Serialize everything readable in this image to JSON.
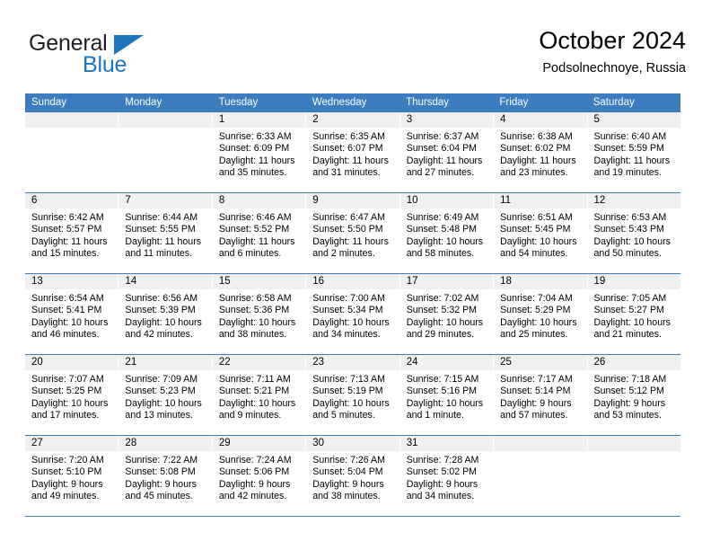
{
  "brand": {
    "line1": "General",
    "line2": "Blue",
    "triangle_color": "#1d76bd",
    "text_color": "#231f20"
  },
  "header": {
    "title": "October 2024",
    "subtitle": "Podsolnechnoye, Russia"
  },
  "calendar": {
    "accent_color": "#3b7dbf",
    "daynum_bg": "#f0f0f0",
    "weekdays": [
      "Sunday",
      "Monday",
      "Tuesday",
      "Wednesday",
      "Thursday",
      "Friday",
      "Saturday"
    ],
    "weeks": [
      [
        {
          "day": "",
          "sunrise": "",
          "sunset": "",
          "daylight1": "",
          "daylight2": ""
        },
        {
          "day": "",
          "sunrise": "",
          "sunset": "",
          "daylight1": "",
          "daylight2": ""
        },
        {
          "day": "1",
          "sunrise": "Sunrise: 6:33 AM",
          "sunset": "Sunset: 6:09 PM",
          "daylight1": "Daylight: 11 hours",
          "daylight2": "and 35 minutes."
        },
        {
          "day": "2",
          "sunrise": "Sunrise: 6:35 AM",
          "sunset": "Sunset: 6:07 PM",
          "daylight1": "Daylight: 11 hours",
          "daylight2": "and 31 minutes."
        },
        {
          "day": "3",
          "sunrise": "Sunrise: 6:37 AM",
          "sunset": "Sunset: 6:04 PM",
          "daylight1": "Daylight: 11 hours",
          "daylight2": "and 27 minutes."
        },
        {
          "day": "4",
          "sunrise": "Sunrise: 6:38 AM",
          "sunset": "Sunset: 6:02 PM",
          "daylight1": "Daylight: 11 hours",
          "daylight2": "and 23 minutes."
        },
        {
          "day": "5",
          "sunrise": "Sunrise: 6:40 AM",
          "sunset": "Sunset: 5:59 PM",
          "daylight1": "Daylight: 11 hours",
          "daylight2": "and 19 minutes."
        }
      ],
      [
        {
          "day": "6",
          "sunrise": "Sunrise: 6:42 AM",
          "sunset": "Sunset: 5:57 PM",
          "daylight1": "Daylight: 11 hours",
          "daylight2": "and 15 minutes."
        },
        {
          "day": "7",
          "sunrise": "Sunrise: 6:44 AM",
          "sunset": "Sunset: 5:55 PM",
          "daylight1": "Daylight: 11 hours",
          "daylight2": "and 11 minutes."
        },
        {
          "day": "8",
          "sunrise": "Sunrise: 6:46 AM",
          "sunset": "Sunset: 5:52 PM",
          "daylight1": "Daylight: 11 hours",
          "daylight2": "and 6 minutes."
        },
        {
          "day": "9",
          "sunrise": "Sunrise: 6:47 AM",
          "sunset": "Sunset: 5:50 PM",
          "daylight1": "Daylight: 11 hours",
          "daylight2": "and 2 minutes."
        },
        {
          "day": "10",
          "sunrise": "Sunrise: 6:49 AM",
          "sunset": "Sunset: 5:48 PM",
          "daylight1": "Daylight: 10 hours",
          "daylight2": "and 58 minutes."
        },
        {
          "day": "11",
          "sunrise": "Sunrise: 6:51 AM",
          "sunset": "Sunset: 5:45 PM",
          "daylight1": "Daylight: 10 hours",
          "daylight2": "and 54 minutes."
        },
        {
          "day": "12",
          "sunrise": "Sunrise: 6:53 AM",
          "sunset": "Sunset: 5:43 PM",
          "daylight1": "Daylight: 10 hours",
          "daylight2": "and 50 minutes."
        }
      ],
      [
        {
          "day": "13",
          "sunrise": "Sunrise: 6:54 AM",
          "sunset": "Sunset: 5:41 PM",
          "daylight1": "Daylight: 10 hours",
          "daylight2": "and 46 minutes."
        },
        {
          "day": "14",
          "sunrise": "Sunrise: 6:56 AM",
          "sunset": "Sunset: 5:39 PM",
          "daylight1": "Daylight: 10 hours",
          "daylight2": "and 42 minutes."
        },
        {
          "day": "15",
          "sunrise": "Sunrise: 6:58 AM",
          "sunset": "Sunset: 5:36 PM",
          "daylight1": "Daylight: 10 hours",
          "daylight2": "and 38 minutes."
        },
        {
          "day": "16",
          "sunrise": "Sunrise: 7:00 AM",
          "sunset": "Sunset: 5:34 PM",
          "daylight1": "Daylight: 10 hours",
          "daylight2": "and 34 minutes."
        },
        {
          "day": "17",
          "sunrise": "Sunrise: 7:02 AM",
          "sunset": "Sunset: 5:32 PM",
          "daylight1": "Daylight: 10 hours",
          "daylight2": "and 29 minutes."
        },
        {
          "day": "18",
          "sunrise": "Sunrise: 7:04 AM",
          "sunset": "Sunset: 5:29 PM",
          "daylight1": "Daylight: 10 hours",
          "daylight2": "and 25 minutes."
        },
        {
          "day": "19",
          "sunrise": "Sunrise: 7:05 AM",
          "sunset": "Sunset: 5:27 PM",
          "daylight1": "Daylight: 10 hours",
          "daylight2": "and 21 minutes."
        }
      ],
      [
        {
          "day": "20",
          "sunrise": "Sunrise: 7:07 AM",
          "sunset": "Sunset: 5:25 PM",
          "daylight1": "Daylight: 10 hours",
          "daylight2": "and 17 minutes."
        },
        {
          "day": "21",
          "sunrise": "Sunrise: 7:09 AM",
          "sunset": "Sunset: 5:23 PM",
          "daylight1": "Daylight: 10 hours",
          "daylight2": "and 13 minutes."
        },
        {
          "day": "22",
          "sunrise": "Sunrise: 7:11 AM",
          "sunset": "Sunset: 5:21 PM",
          "daylight1": "Daylight: 10 hours",
          "daylight2": "and 9 minutes."
        },
        {
          "day": "23",
          "sunrise": "Sunrise: 7:13 AM",
          "sunset": "Sunset: 5:19 PM",
          "daylight1": "Daylight: 10 hours",
          "daylight2": "and 5 minutes."
        },
        {
          "day": "24",
          "sunrise": "Sunrise: 7:15 AM",
          "sunset": "Sunset: 5:16 PM",
          "daylight1": "Daylight: 10 hours",
          "daylight2": "and 1 minute."
        },
        {
          "day": "25",
          "sunrise": "Sunrise: 7:17 AM",
          "sunset": "Sunset: 5:14 PM",
          "daylight1": "Daylight: 9 hours",
          "daylight2": "and 57 minutes."
        },
        {
          "day": "26",
          "sunrise": "Sunrise: 7:18 AM",
          "sunset": "Sunset: 5:12 PM",
          "daylight1": "Daylight: 9 hours",
          "daylight2": "and 53 minutes."
        }
      ],
      [
        {
          "day": "27",
          "sunrise": "Sunrise: 7:20 AM",
          "sunset": "Sunset: 5:10 PM",
          "daylight1": "Daylight: 9 hours",
          "daylight2": "and 49 minutes."
        },
        {
          "day": "28",
          "sunrise": "Sunrise: 7:22 AM",
          "sunset": "Sunset: 5:08 PM",
          "daylight1": "Daylight: 9 hours",
          "daylight2": "and 45 minutes."
        },
        {
          "day": "29",
          "sunrise": "Sunrise: 7:24 AM",
          "sunset": "Sunset: 5:06 PM",
          "daylight1": "Daylight: 9 hours",
          "daylight2": "and 42 minutes."
        },
        {
          "day": "30",
          "sunrise": "Sunrise: 7:26 AM",
          "sunset": "Sunset: 5:04 PM",
          "daylight1": "Daylight: 9 hours",
          "daylight2": "and 38 minutes."
        },
        {
          "day": "31",
          "sunrise": "Sunrise: 7:28 AM",
          "sunset": "Sunset: 5:02 PM",
          "daylight1": "Daylight: 9 hours",
          "daylight2": "and 34 minutes."
        },
        {
          "day": "",
          "sunrise": "",
          "sunset": "",
          "daylight1": "",
          "daylight2": ""
        },
        {
          "day": "",
          "sunrise": "",
          "sunset": "",
          "daylight1": "",
          "daylight2": ""
        }
      ]
    ]
  }
}
